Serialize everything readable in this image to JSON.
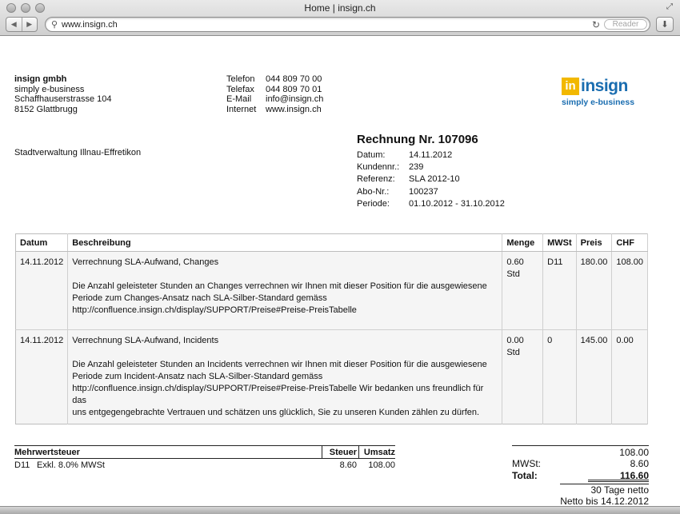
{
  "browser": {
    "window_title": "Home | insign.ch",
    "url": "www.insign.ch",
    "reader_label": "Reader",
    "back_glyph": "◀",
    "forward_glyph": "▶"
  },
  "company": {
    "name": "insign gmbh",
    "tagline": "simply e-business",
    "street": "Schaffhauserstrasse 104",
    "city": "8152 Glattbrugg"
  },
  "contact": [
    {
      "label": "Telefon",
      "value": "044 809 70 00"
    },
    {
      "label": "Telefax",
      "value": "044 809 70 01"
    },
    {
      "label": "E-Mail",
      "value": "info@insign.ch"
    },
    {
      "label": "Internet",
      "value": "www.insign.ch"
    }
  ],
  "logo": {
    "box": "in",
    "word": "insign",
    "sub": "simply e-business",
    "colors": {
      "box": "#f2b800",
      "text": "#1a6db0"
    }
  },
  "recipient": "Stadtverwaltung Illnau-Effretikon",
  "invoice": {
    "title": "Rechnung Nr. 107096",
    "meta": [
      {
        "label": "Datum:",
        "value": "14.11.2012"
      },
      {
        "label": "Kundennr.:",
        "value": "239"
      },
      {
        "label": "Referenz:",
        "value": "SLA 2012-10"
      },
      {
        "label": "Abo-Nr.:",
        "value": "100237"
      },
      {
        "label": "Periode:",
        "value": "01.10.2012 - 31.10.2012"
      }
    ]
  },
  "items": {
    "headers": {
      "date": "Datum",
      "desc": "Beschreibung",
      "qty": "Menge",
      "vat": "MWSt",
      "price": "Preis",
      "chf": "CHF"
    },
    "rows": [
      {
        "date": "14.11.2012",
        "title": "Verrechnung SLA-Aufwand, Changes",
        "lines": [
          "Die Anzahl geleisteter Stunden an Changes verrechnen wir Ihnen mit dieser Position für die ausgewiesene",
          "Periode zum Changes-Ansatz nach SLA-Silber-Standard gemäss",
          "http://confluence.insign.ch/display/SUPPORT/Preise#Preise-PreisTabelle"
        ],
        "qty": "0.60 Std",
        "vat": "D11",
        "price": "180.00",
        "chf": "108.00"
      },
      {
        "date": "14.11.2012",
        "title": "Verrechnung SLA-Aufwand, Incidents",
        "lines": [
          "Die Anzahl geleisteter Stunden an Incidents verrechnen wir Ihnen mit dieser Position für die ausgewiesene",
          "Periode zum Incident-Ansatz nach SLA-Silber-Standard gemäss",
          "http://confluence.insign.ch/display/SUPPORT/Preise#Preise-PreisTabelle Wir bedanken uns freundlich für das",
          "uns entgegengebrachte Vertrauen und schätzen uns glücklich, Sie zu unseren Kunden zählen zu dürfen."
        ],
        "qty": "0.00 Std",
        "vat": "0",
        "price": "145.00",
        "chf": "0.00"
      }
    ]
  },
  "vat_summary": {
    "headers": {
      "label": "Mehrwertsteuer",
      "tax": "Steuer",
      "base": "Umsatz"
    },
    "row": {
      "code": "D11",
      "text": "Exkl. 8.0% MWSt",
      "tax": "8.60",
      "base": "108.00"
    }
  },
  "totals": {
    "subtotal": "108.00",
    "vat_label": "MWSt:",
    "vat_value": "8.60",
    "total_label": "Total:",
    "total_value": "116.60",
    "terms": "30 Tage netto",
    "due": "Netto bis 14.12.2012"
  }
}
